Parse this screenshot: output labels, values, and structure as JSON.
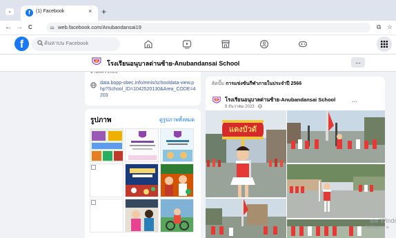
{
  "browser": {
    "tab_title": "(1) Facebook",
    "tab_favicon": "f",
    "tab_close": "×",
    "new_tab": "+",
    "tabs_menu": "⌄",
    "url": "web.facebook.com/Anubandansai19",
    "back": "←",
    "forward": "→",
    "reload": "C",
    "site_info": "⚌",
    "right_icons": [
      "⧉",
      "☆"
    ]
  },
  "facebook": {
    "logo": "f",
    "search_placeholder": "ค้นหาบน Facebook",
    "menu_icon": "⋮⋮⋮",
    "brand_color": "#1877f2"
  },
  "page": {
    "name": "โรงเรียนอนุบาลด่านซ้าย-Anubandansai School",
    "more": "..."
  },
  "intro": {
    "partial_line": "ย้ายแล้ว 2023",
    "link": "data.bopp-obec.info/emis/schooldata-view.php?School_ID=1042520130&Area_CODE=4203"
  },
  "photos": {
    "title": "รูปภาพ",
    "see_all": "ดูรูปภาพทั้งหมด"
  },
  "post": {
    "header_prefix": "ติดปั๊ม",
    "header_title": "การแข่งขันกีฬาภายในประจำปี 2566",
    "author": "โรงเรียนอนุบาลด่านซ้าย-Anubandansai School",
    "date": "9 ธันวาคม 2023 · ",
    "more": "...",
    "banner_text": "แดงบัวดั"
  },
  "overlay": {
    "activate": "ate Windo",
    "settings": "Settings to a"
  }
}
